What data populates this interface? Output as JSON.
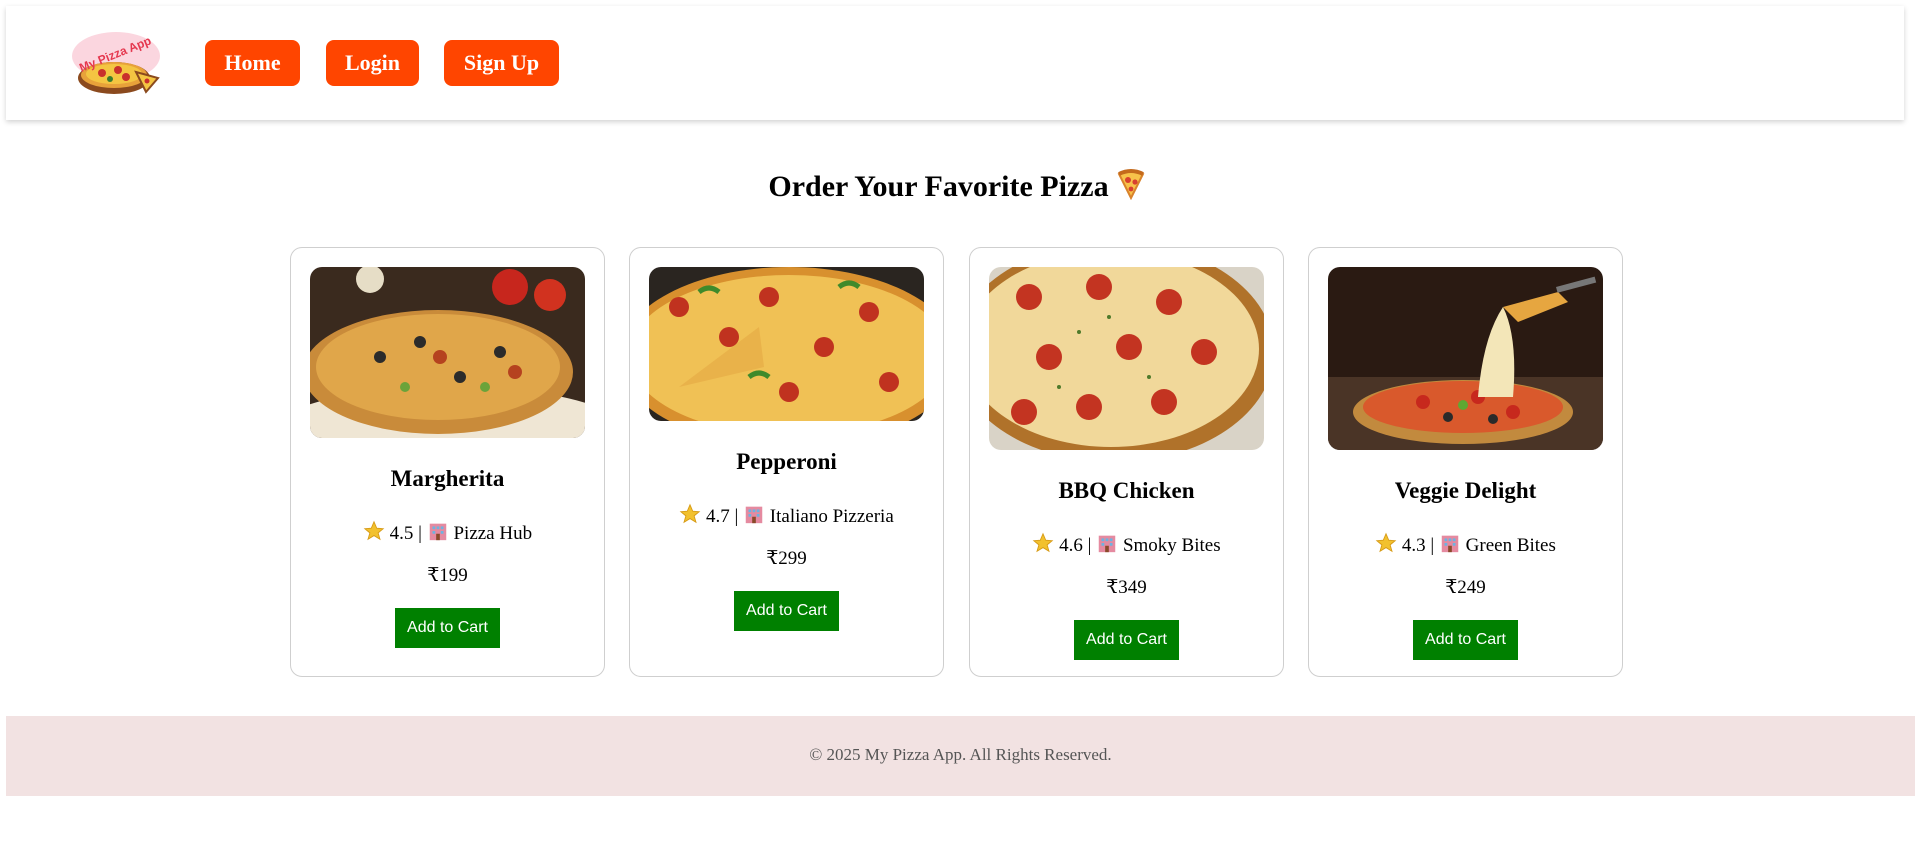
{
  "navbar": {
    "logo_text": "My Pizza App",
    "links": [
      "Home",
      "Login",
      "Sign Up"
    ]
  },
  "main": {
    "title": "Order Your Favorite Pizza",
    "pizzas": [
      {
        "name": "Margherita",
        "rating": "4.5",
        "restaurant": "Pizza Hub",
        "price": "₹199",
        "button": "Add to Cart"
      },
      {
        "name": "Pepperoni",
        "rating": "4.7",
        "restaurant": "Italiano Pizzeria",
        "price": "₹299",
        "button": "Add to Cart"
      },
      {
        "name": "BBQ Chicken",
        "rating": "4.6",
        "restaurant": "Smoky Bites",
        "price": "₹349",
        "button": "Add to Cart"
      },
      {
        "name": "Veggie Delight",
        "rating": "4.3",
        "restaurant": "Green Bites",
        "price": "₹249",
        "button": "Add to Cart"
      }
    ]
  },
  "footer": {
    "text": "© 2025 My Pizza App. All Rights Reserved."
  },
  "colors": {
    "nav_button": "#ff4500",
    "cart_button": "#008000",
    "footer_bg": "#f2e2e2"
  },
  "icons": [
    "pizza-logo-icon",
    "pizza-slice-icon",
    "star-icon",
    "building-icon"
  ]
}
